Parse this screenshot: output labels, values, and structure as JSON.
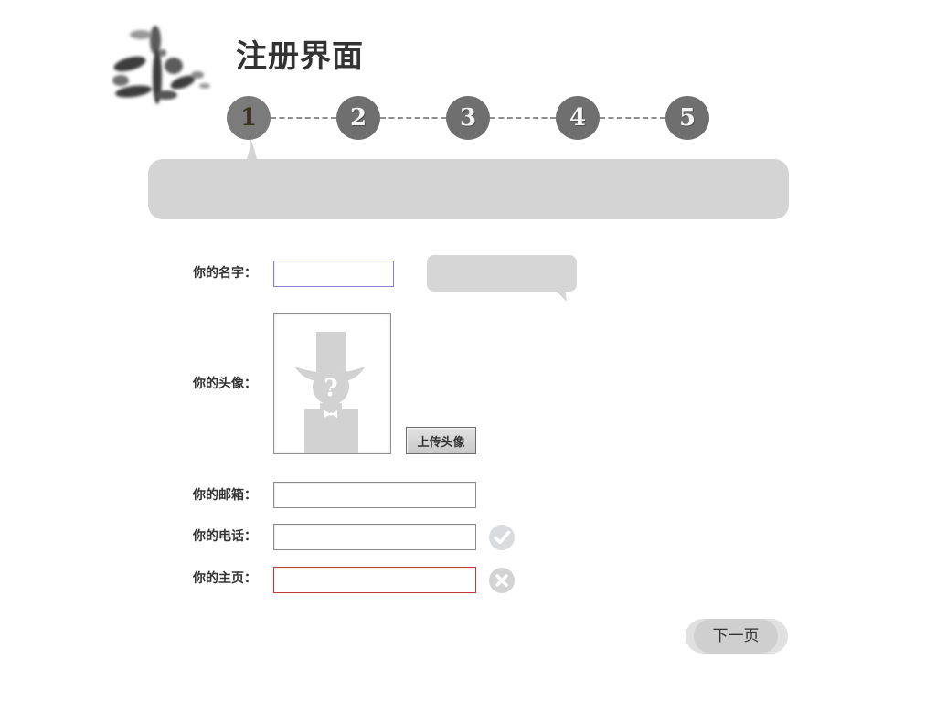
{
  "header": {
    "title": "注册界面",
    "logo_icon": "calligraphy-logo-icon"
  },
  "steps": {
    "items": [
      {
        "label": "1",
        "state": "active"
      },
      {
        "label": "2",
        "state": "pending"
      },
      {
        "label": "3",
        "state": "pending"
      },
      {
        "label": "4",
        "state": "pending"
      },
      {
        "label": "5",
        "state": "pending"
      }
    ],
    "current": 1
  },
  "form": {
    "name": {
      "label": "你的名字：",
      "value": "",
      "placeholder": ""
    },
    "avatar": {
      "label": "你的头像：",
      "upload_label": "上传头像",
      "placeholder_icon": "mystery-person-icon"
    },
    "email": {
      "label": "你的邮箱：",
      "value": "",
      "placeholder": ""
    },
    "phone": {
      "label": "你的电话：",
      "value": "",
      "placeholder": "",
      "status": "valid",
      "status_icon": "check-circle-icon"
    },
    "homepage": {
      "label": "你的主页：",
      "value": "",
      "placeholder": "",
      "status": "invalid",
      "status_icon": "x-circle-icon"
    }
  },
  "actions": {
    "next_label": "下一页"
  },
  "colors": {
    "panel_gray": "#d4d4d4",
    "step_gray": "#6f6f6f",
    "error_border": "#c33a3a",
    "focus_border": "#8a7fd0"
  }
}
